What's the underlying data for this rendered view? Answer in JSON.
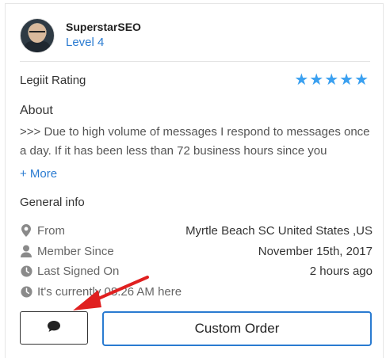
{
  "profile": {
    "username": "SuperstarSEO",
    "level": "Level 4"
  },
  "rating": {
    "label": "Legiit Rating",
    "stars": 5,
    "star_color": "#3aa0f0"
  },
  "about": {
    "heading": "About",
    "text": ">>> Due to high volume of messages I respond to messages once a day. If it has been less than 72 business hours since you",
    "more_label": "+ More"
  },
  "general": {
    "heading": "General info",
    "rows": [
      {
        "icon": "map-pin-icon",
        "label": "From",
        "value": "Myrtle Beach SC United States ,US"
      },
      {
        "icon": "user-icon",
        "label": "Member Since",
        "value": "November 15th, 2017"
      },
      {
        "icon": "clock-icon",
        "label": "Last Signed On",
        "value": "2 hours ago"
      },
      {
        "icon": "clock-icon",
        "label": "It's currently 08:26 AM here",
        "value": ""
      }
    ]
  },
  "actions": {
    "message_icon": "chat-bubble-icon",
    "custom_order_label": "Custom Order"
  },
  "colors": {
    "accent": "#2a7bd1",
    "annotation_arrow": "#e02020"
  }
}
